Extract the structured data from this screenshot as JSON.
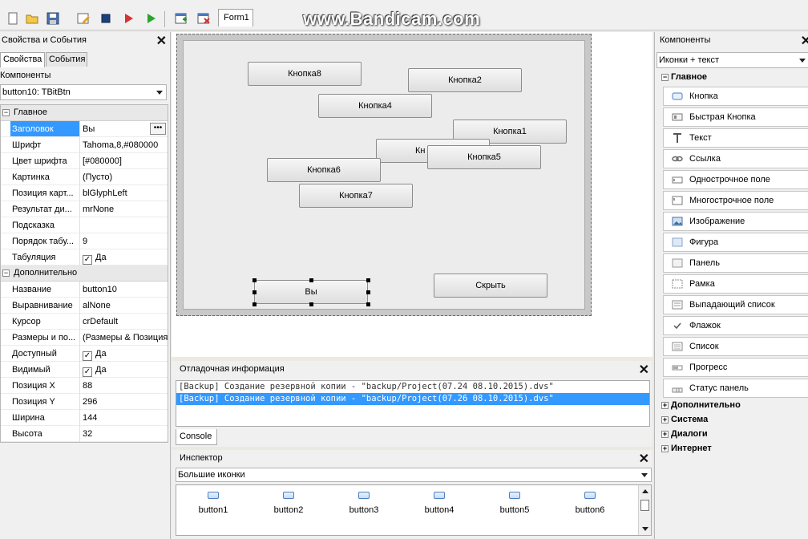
{
  "watermark": "www.Bandicam.com",
  "form_tab": "Form1",
  "left_panel": {
    "title": "Свойства и События",
    "tabs": [
      "Свойства",
      "События"
    ],
    "components_label": "Компоненты",
    "selected_component": "button10: TBitBtn",
    "sections": [
      {
        "name": "Главное",
        "rows": [
          {
            "key": "Заголовок",
            "value": "Вы"
          },
          {
            "key": "Шрифт",
            "value": "Tahoma,8,#080000"
          },
          {
            "key": "Цвет шрифта",
            "value": "[#080000]"
          },
          {
            "key": "Картинка",
            "value": "(Пусто)"
          },
          {
            "key": "Позиция карт...",
            "value": "blGlyphLeft"
          },
          {
            "key": "Результат ди...",
            "value": "mrNone"
          },
          {
            "key": "Подсказка",
            "value": ""
          },
          {
            "key": "Порядок табу...",
            "value": "9"
          },
          {
            "key": "Табуляция",
            "value": "Да",
            "checked": true
          }
        ]
      },
      {
        "name": "Дополнительно",
        "rows": [
          {
            "key": "Название",
            "value": "button10"
          },
          {
            "key": "Выравнивание",
            "value": "alNone"
          },
          {
            "key": "Курсор",
            "value": "crDefault"
          },
          {
            "key": "Размеры и по...",
            "value": "(Размеры & Позиция)"
          },
          {
            "key": "Доступный",
            "value": "Да",
            "checked": true
          },
          {
            "key": "Видимый",
            "value": "Да",
            "checked": true
          },
          {
            "key": "Позиция X",
            "value": "88"
          },
          {
            "key": "Позиция Y",
            "value": "296"
          },
          {
            "key": "Ширина",
            "value": "144"
          },
          {
            "key": "Высота",
            "value": "32"
          }
        ]
      }
    ]
  },
  "design_buttons": {
    "b8": "Кнопка8",
    "b2": "Кнопка2",
    "b4": "Кнопка4",
    "b1": "Кнопка1",
    "b3": "Кн",
    "b5": "Кнопка5",
    "b6": "Кнопка6",
    "b7": "Кнопка7",
    "b10": "Вы",
    "hide": "Скрыть"
  },
  "right_panel": {
    "title": "Компоненты",
    "view_mode": "Иконки + текст",
    "expanded_category": "Главное",
    "items": [
      "Кнопка",
      "Быстрая Кнопка",
      "Текст",
      "Ссылка",
      "Однострочное поле",
      "Многострочное поле",
      "Изображение",
      "Фигура",
      "Панель",
      "Рамка",
      "Выпадающий список",
      "Флажок",
      "Список",
      "Прогресс",
      "Статус панель"
    ],
    "collapsed_categories": [
      "Дополнительно",
      "Система",
      "Диалоги",
      "Интернет"
    ]
  },
  "debug": {
    "title": "Отладочная информация",
    "lines": [
      "[Backup] Создание резервной копии - \"backup/Project(07.24 08.10.2015).dvs\"",
      "[Backup] Создание резервной копии - \"backup/Project(07.26 08.10.2015).dvs\""
    ],
    "console_tab": "Console"
  },
  "inspector": {
    "title": "Инспектор",
    "view_mode": "Большие иконки",
    "items": [
      "button1",
      "button2",
      "button3",
      "button4",
      "button5",
      "button6"
    ]
  }
}
